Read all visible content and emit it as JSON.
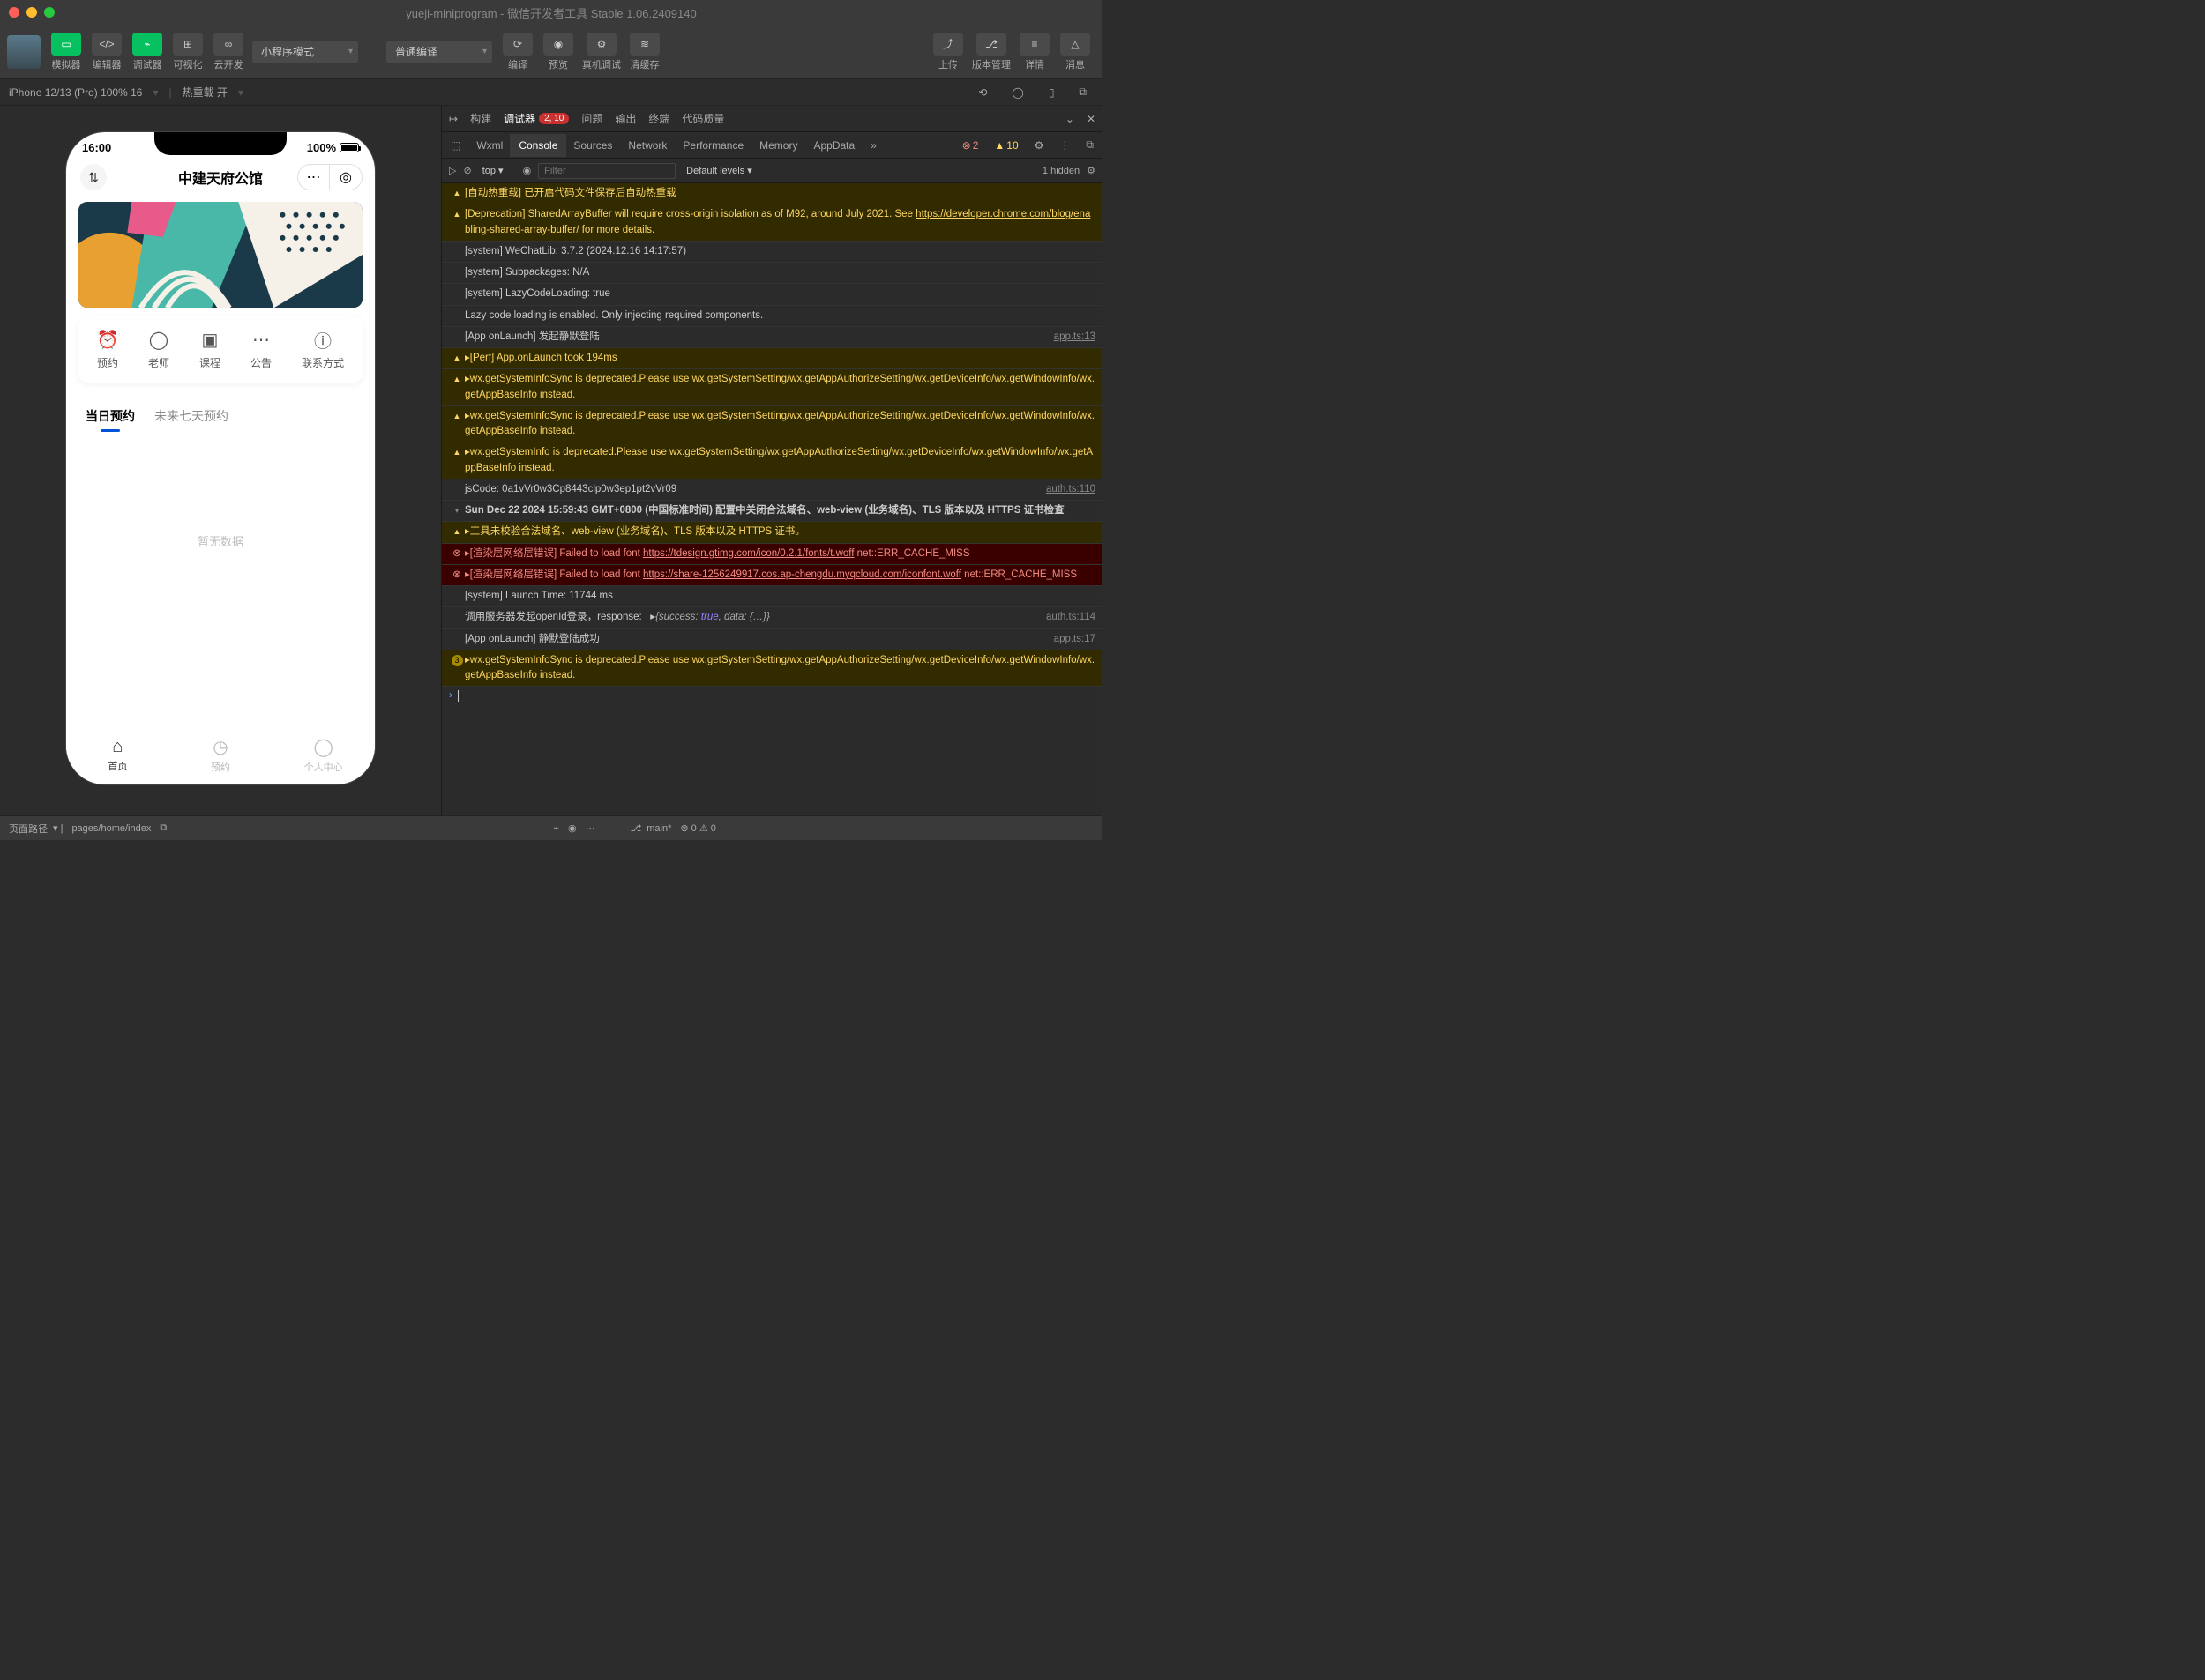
{
  "window": {
    "title": "yueji-miniprogram - 微信开发者工具 Stable 1.06.2409140"
  },
  "toolbar": {
    "buttons": {
      "simulator": "模拟器",
      "editor": "编辑器",
      "debugger": "调试器",
      "visualize": "可视化",
      "cloud": "云开发"
    },
    "mode_dropdown": "小程序模式",
    "compile_dropdown": "普通编译",
    "compile": "编译",
    "preview": "预览",
    "remote": "真机调试",
    "clear_cache": "清缓存",
    "upload": "上传",
    "version": "版本管理",
    "details": "详情",
    "notifications": "消息"
  },
  "device_bar": {
    "device": "iPhone 12/13 (Pro) 100% 16",
    "hotreload": "热重载 开"
  },
  "simulator": {
    "time": "16:00",
    "battery": "100%",
    "app_title": "中建天府公馆",
    "menu": {
      "reserve": "预约",
      "teacher": "老师",
      "course": "课程",
      "notice": "公告",
      "contact": "联系方式"
    },
    "tabs": {
      "today": "当日预约",
      "week": "未来七天预约"
    },
    "empty": "暂无数据",
    "tabbar": {
      "home": "首页",
      "reserve": "预约",
      "profile": "个人中心"
    }
  },
  "devtools": {
    "top_tabs": {
      "build": "构建",
      "debugger": "调试器",
      "badge": "2, 10",
      "issues": "问题",
      "output": "输出",
      "terminal": "终端",
      "code_quality": "代码质量"
    },
    "panels": {
      "wxml": "Wxml",
      "console": "Console",
      "sources": "Sources",
      "network": "Network",
      "performance": "Performance",
      "memory": "Memory",
      "appdata": "AppData",
      "error_count": "2",
      "warn_count": "10"
    },
    "console_toolbar": {
      "context": "top",
      "filter_placeholder": "Filter",
      "levels": "Default levels",
      "hidden": "1 hidden"
    },
    "logs": [
      {
        "type": "warn",
        "icon": "warn",
        "msg": "[自动热重载] 已开启代码文件保存后自动热重载",
        "src": ""
      },
      {
        "type": "warn",
        "icon": "warn",
        "msg": "[Deprecation] SharedArrayBuffer will require cross-origin isolation as of M92, around July 2021. See https://developer.chrome.com/blog/enabling-shared-array-buffer/ for more details.",
        "src": ""
      },
      {
        "type": "info",
        "icon": "",
        "msg": "[system] WeChatLib: 3.7.2 (2024.12.16 14:17:57)",
        "src": ""
      },
      {
        "type": "info",
        "icon": "",
        "msg": "[system] Subpackages: N/A",
        "src": ""
      },
      {
        "type": "info",
        "icon": "",
        "msg": "[system] LazyCodeLoading: true",
        "src": ""
      },
      {
        "type": "info",
        "icon": "",
        "msg": "Lazy code loading is enabled. Only injecting required components.",
        "src": ""
      },
      {
        "type": "info",
        "icon": "",
        "msg": "[App onLaunch] 发起静默登陆",
        "src": "app.ts:13"
      },
      {
        "type": "warn",
        "icon": "warn",
        "msg": "▸[Perf] App.onLaunch took 194ms",
        "src": ""
      },
      {
        "type": "warn",
        "icon": "warn",
        "msg": "▸wx.getSystemInfoSync is deprecated.Please use wx.getSystemSetting/wx.getAppAuthorizeSetting/wx.getDeviceInfo/wx.getWindowInfo/wx.getAppBaseInfo instead.",
        "src": ""
      },
      {
        "type": "warn",
        "icon": "warn",
        "msg": "▸wx.getSystemInfoSync is deprecated.Please use wx.getSystemSetting/wx.getAppAuthorizeSetting/wx.getDeviceInfo/wx.getWindowInfo/wx.getAppBaseInfo instead.",
        "src": ""
      },
      {
        "type": "warn",
        "icon": "warn",
        "msg": "▸wx.getSystemInfo is deprecated.Please use wx.getSystemSetting/wx.getAppAuthorizeSetting/wx.getDeviceInfo/wx.getWindowInfo/wx.getAppBaseInfo instead.",
        "src": ""
      },
      {
        "type": "info",
        "icon": "",
        "msg": "jsCode: 0a1vVr0w3Cp8443clp0w3ep1pt2vVr09",
        "src": "auth.ts:110"
      },
      {
        "type": "info",
        "icon": "expand-down",
        "msg": "Sun Dec 22 2024 15:59:43 GMT+0800 (中国标准时间) 配置中关闭合法域名、web-view (业务域名)、TLS 版本以及 HTTPS 证书检查",
        "bold": true,
        "src": ""
      },
      {
        "type": "warn",
        "icon": "warn",
        "msg": "▸工具未校验合法域名、web-view (业务域名)、TLS 版本以及 HTTPS 证书。",
        "src": ""
      },
      {
        "type": "error",
        "icon": "error",
        "msg": "▸[渲染层网络层错误] Failed to load font https://tdesign.gtimg.com/icon/0.2.1/fonts/t.woff net::ERR_CACHE_MISS",
        "src": ""
      },
      {
        "type": "error",
        "icon": "error",
        "msg": "▸[渲染层网络层错误] Failed to load font https://share-1256249917.cos.ap-chengdu.myqcloud.com/iconfont.woff net::ERR_CACHE_MISS",
        "src": ""
      },
      {
        "type": "info",
        "icon": "",
        "msg": "[system] Launch Time: 11744 ms",
        "src": ""
      },
      {
        "type": "info",
        "icon": "",
        "msg": "调用服务器发起openId登录，response:   ▸{success: true, data: {…}}",
        "src": "auth.ts:114",
        "rich": true
      },
      {
        "type": "info",
        "icon": "",
        "msg": "[App onLaunch] 静默登陆成功",
        "src": "app.ts:17"
      },
      {
        "type": "warn",
        "icon": "badge3",
        "msg": "▸wx.getSystemInfoSync is deprecated.Please use wx.getSystemSetting/wx.getAppAuthorizeSetting/wx.getDeviceInfo/wx.getWindowInfo/wx.getAppBaseInfo instead.",
        "src": ""
      }
    ]
  },
  "status_bar": {
    "page_path_label": "页面路径",
    "page_path": "pages/home/index",
    "branch": "main*",
    "sync": "⟲ 0 ↓ 0"
  }
}
